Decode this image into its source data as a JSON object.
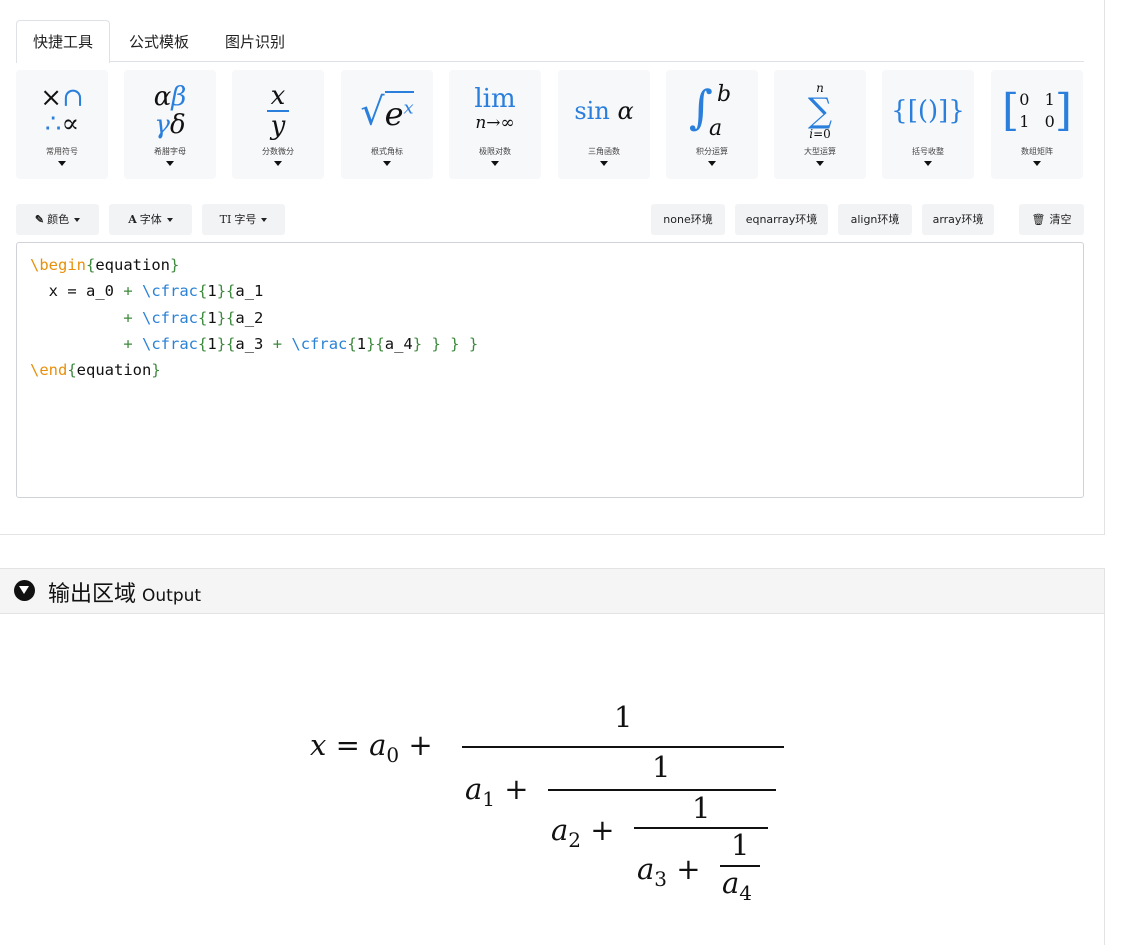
{
  "tabs": [
    {
      "label": "快捷工具",
      "active": true
    },
    {
      "label": "公式模板",
      "active": false
    },
    {
      "label": "图片识别",
      "active": false
    }
  ],
  "tools": [
    {
      "label": "常用符号",
      "icon": "symbols-icon"
    },
    {
      "label": "希腊字母",
      "icon": "greek-letters-icon"
    },
    {
      "label": "分数微分",
      "icon": "fraction-icon"
    },
    {
      "label": "根式角标",
      "icon": "radical-icon"
    },
    {
      "label": "极限对数",
      "icon": "limit-icon"
    },
    {
      "label": "三角函数",
      "icon": "trig-icon"
    },
    {
      "label": "积分运算",
      "icon": "integral-icon"
    },
    {
      "label": "大型运算",
      "icon": "sum-icon"
    },
    {
      "label": "括号收整",
      "icon": "brackets-icon"
    },
    {
      "label": "数组矩阵",
      "icon": "matrix-icon"
    }
  ],
  "toolbar": {
    "color": "颜色",
    "font": "字体",
    "size": "字号",
    "env_none": "none环境",
    "env_eqnarray": "eqnarray环境",
    "env_align": "align环境",
    "env_array": "array环境",
    "clear": "清空"
  },
  "editor": {
    "lines": [
      "\\begin{equation}",
      "  x = a_0 + \\cfrac{1}{a_1",
      "          + \\cfrac{1}{a_2",
      "          + \\cfrac{1}{a_3 + \\cfrac{1}{a_4} } } }",
      "\\end{equation}"
    ]
  },
  "output": {
    "title": "输出区域",
    "subtitle": "Output"
  },
  "colors": {
    "accent_blue": "#2a7fdc",
    "keyword_orange": "#e8900c",
    "brace_green": "#3d8a3d"
  }
}
